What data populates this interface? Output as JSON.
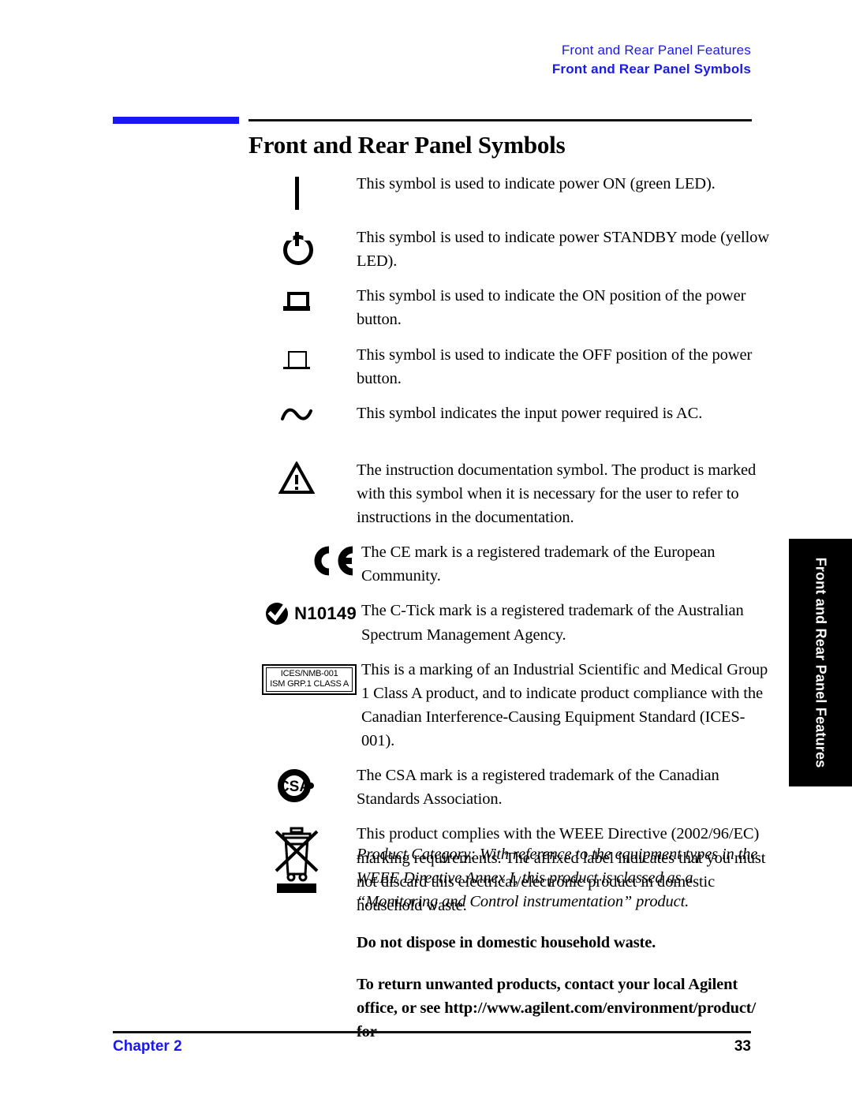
{
  "header": {
    "line1": "Front and Rear Panel Features",
    "line2": "Front and Rear Panel Symbols",
    "color": "#1a1ae8"
  },
  "title": "Front and Rear Panel Symbols",
  "symbols": [
    {
      "icon": "power-on-bar-icon",
      "description": "This symbol is used to indicate power ON (green LED)."
    },
    {
      "icon": "power-standby-icon",
      "description": "This symbol is used to indicate power STANDBY mode (yellow LED)."
    },
    {
      "icon": "power-button-on-position-icon",
      "description": "This symbol is used to indicate the ON position of the power button."
    },
    {
      "icon": "power-button-off-position-icon",
      "description": "This symbol is used to indicate the OFF position of the power button."
    },
    {
      "icon": "ac-power-icon",
      "description": "This symbol indicates the input power required is AC."
    },
    {
      "icon": "warning-triangle-icon",
      "description": "The instruction documentation symbol. The product is marked with this symbol when it is necessary for the user to refer to instructions in the documentation."
    },
    {
      "icon": "ce-mark-icon",
      "description": "The CE mark is a registered trademark of the European Community."
    },
    {
      "icon": "c-tick-mark-icon",
      "label": "N10149",
      "description": "The C-Tick mark is a registered trademark of the Australian Spectrum Management Agency."
    },
    {
      "icon": "ices-nmb-label-icon",
      "box_line1": "ICES/NMB-001",
      "box_line2": "ISM GRP.1 CLASS A",
      "description": "This is a marking of an Industrial Scientific and Medical Group 1 Class A product, and to indicate product compliance with the Canadian Interference-Causing Equipment Standard (ICES-001)."
    },
    {
      "icon": "csa-mark-icon",
      "description": "The CSA mark is a registered trademark of the Canadian Standards Association."
    },
    {
      "icon": "weee-crossed-bin-icon",
      "description": "This product complies with the WEEE Directive (2002/96/EC) marking requirements. The affixed label indicates that you must not discard this electrical/electronic product in domestic household waste."
    }
  ],
  "tail": {
    "product_category": "Product Category: With reference to the equipment types in the WEEE Directive Annex I, this product is classed as a “Monitoring and Control instrumentation” product.",
    "do_not_dispose": "Do not dispose in domestic household waste.",
    "return_instructions": "To return unwanted products, contact your local Agilent office, or see http://www.agilent.com/environment/product/ for"
  },
  "side_tab": {
    "label": "Front and Rear Panel Features"
  },
  "footer": {
    "chapter": "Chapter 2",
    "page": "33"
  }
}
